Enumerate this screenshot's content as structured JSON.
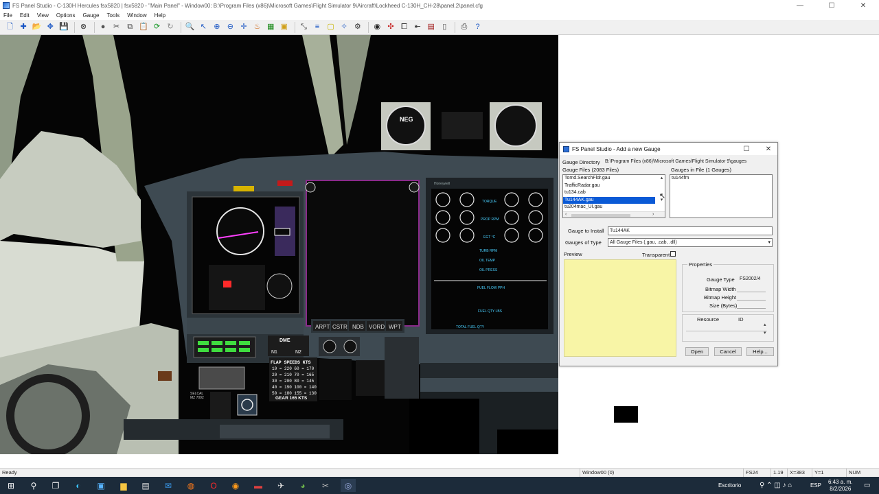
{
  "window": {
    "title": "FS Panel Studio - C-130H Hercules fsx5820 | fsx5820 - \"Main Panel\" - Window00: B:\\Program Files (x86)\\Microsoft Games\\Flight Simulator 9\\Aircraft\\Lockheed C-130H_CH-28\\panel.2\\panel.cfg",
    "controls": {
      "minimize": "—",
      "maximize": "☐",
      "close": "✕"
    }
  },
  "menu": [
    "File",
    "Edit",
    "View",
    "Options",
    "Gauge",
    "Tools",
    "Window",
    "Help"
  ],
  "toolbar": {
    "icons": [
      "new-icon",
      "add-icon",
      "open-icon",
      "move-icon",
      "save-icon",
      "stop-icon",
      "record-icon",
      "cut-icon",
      "copy-icon",
      "paste-icon",
      "refresh-icon",
      "reload-icon",
      "find-icon",
      "pointer-icon",
      "zoom-in-icon",
      "zoom-out-icon",
      "crosshair-icon",
      "paint-icon",
      "grid-icon",
      "snap-icon",
      "select-icon",
      "align-icon",
      "rectangle-icon",
      "wand-icon",
      "settings-icon",
      "globe-icon",
      "tools-icon",
      "frame-icon",
      "window-icon",
      "film-icon",
      "page-icon",
      "print-icon",
      "help-icon"
    ]
  },
  "cockpit": {
    "colors": {
      "panel": "#3e4a52",
      "frame": "#8f9a86",
      "display": "#050505",
      "glow": "#ff2a2a"
    },
    "labels": {
      "ind_a": "NEG",
      "flap_title": "FLAP SPEEDS KTS",
      "flap_rows": [
        "10 = 220   60 = 170",
        "20 = 210   70 = 165",
        "30 = 200   80 = 145",
        "40 = 190  100 = 140",
        "50 = 180  155 = 130"
      ],
      "gear": "GEAR 165 KTS",
      "dme": "DME",
      "n1": "N1",
      "n2": "N2",
      "softkeys": [
        "ARPT",
        "CSTR",
        "NDB",
        "VORD",
        "WPT"
      ],
      "eicas_torque": "TORQUE",
      "eicas_prop": "PROP RPM",
      "eicas_egt": "EGT °C",
      "eicas_fuel_flow": "FUEL FLOW PPH",
      "eicas_fuel_qty": "FUEL QTY LBS",
      "eicas_total": "TOTAL FUEL QTY",
      "eicas_misc": [
        "TURB RPM",
        "OIL TEMP",
        "OIL PRESS"
      ],
      "selcal": "SELCAL",
      "selcal_code": "MZ 7092",
      "honeywell": "Honeywell"
    }
  },
  "dialog": {
    "title": "FS Panel Studio - Add a new Gauge",
    "gauge_directory_label": "Gauge Directory",
    "gauge_directory_value": "B:\\Program Files (x86)\\Microsoft Games\\Flight Simulator 9\\gauges",
    "gauge_files_label": "Gauge Files  (2083 Files)",
    "gauge_files": [
      "Tomd.SearchFldr.gau",
      "TrafficRadar.gau",
      "tu134.cab",
      "Tu144AK.gau",
      "tu204mac_UI.gau"
    ],
    "selected_file_index": 3,
    "gauges_in_file_label": "Gauges in File  (1 Gauges)",
    "gauges_in_file": [
      "tu144fm"
    ],
    "gauge_to_install_label": "Gauge to Install",
    "gauge_to_install_value": "Tu144AK",
    "gauges_of_type_label": "Gauges of Type",
    "gauges_of_type_value": "All Gauge Files (.gau, .cab, .dll)",
    "preview_label": "Preview",
    "transparent_label": "Transparent",
    "properties_label": "Properties",
    "gauge_type_label": "Gauge Type",
    "gauge_type_value": "FS2002/4",
    "bitmap_width_label": "Bitmap Width",
    "bitmap_height_label": "Bitmap Height",
    "size_label": "Size (Bytes)",
    "resource_label": "Resource",
    "id_label": "ID",
    "open_button": "Open",
    "cancel_button": "Cancel",
    "help_button": "Help...",
    "preview_color": "#f8f5a6"
  },
  "statusbar": {
    "ready": "Ready",
    "window": "Window00 (0)",
    "fs": "FS24",
    "zoom": "1.19",
    "x": "X=383",
    "y": "Y=1",
    "num": "NUM"
  },
  "taskbar": {
    "icons": [
      "windows-start-icon",
      "search-icon",
      "task-view-icon",
      "edge-icon",
      "photos-icon",
      "explorer-icon",
      "store-icon",
      "mail-icon",
      "firefox-icon",
      "opera-icon",
      "app-icon",
      "app2-icon",
      "app3-icon",
      "app4-icon",
      "app5-icon",
      "fspanel-icon"
    ],
    "tray_label": "Escritorio",
    "language": "ESP",
    "time": "6:43 a. m.",
    "date": "8/2/2026"
  }
}
